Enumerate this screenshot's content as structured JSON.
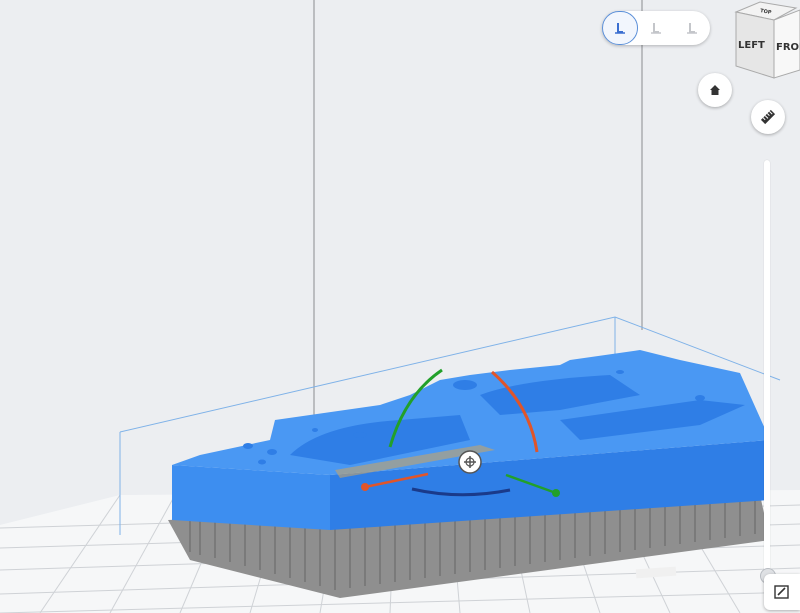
{
  "app": {
    "title": ""
  },
  "view_cube": {
    "faces": {
      "top": "TOP",
      "left": "LEFT",
      "front": "FRONT"
    }
  },
  "view_modes": [
    {
      "icon": "support-view-icon",
      "active": true
    },
    {
      "icon": "support-view-icon",
      "active": false
    },
    {
      "icon": "support-view-icon",
      "active": false
    }
  ],
  "toolbar": {
    "home_icon": "home-icon",
    "measure_icon": "ruler-icon",
    "edit_icon": "edit-icon"
  },
  "layer_slider": {
    "value": 0.0
  },
  "colors": {
    "background": "#eceef1",
    "model": "#3d8ef0",
    "model_shadow": "#2a6ed0",
    "supports": "#9a9a9a",
    "bounding_box": "#7fb2e8",
    "gizmo_x": "#e0552a",
    "gizmo_y": "#22a02a",
    "gizmo_z": "#1a3a8a"
  }
}
